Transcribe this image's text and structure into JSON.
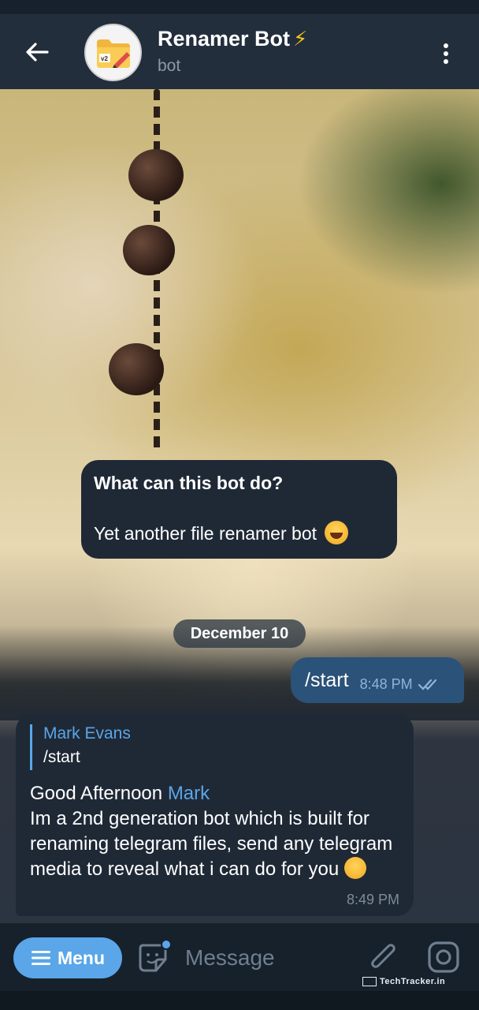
{
  "header": {
    "back_icon": "arrow-left-icon",
    "avatar_icon": "folder-rename-icon",
    "avatar_badge": "v2",
    "title": "Renamer Bot",
    "title_icon": "lightning-bolt-icon",
    "subtitle": "bot",
    "more_icon": "more-vertical-icon"
  },
  "messages": {
    "bot_info": {
      "question": "What can this bot do?",
      "answer": "Yet another file renamer bot",
      "answer_emoji": "laughing-tears-emoji"
    },
    "date_separator": "December 10",
    "outgoing": {
      "text": "/start",
      "time": "8:48 PM",
      "status_icon": "double-check-icon"
    },
    "incoming": {
      "reply_name": "Mark Evans",
      "reply_text": "/start",
      "greeting": "Good Afternoon",
      "mention": "Mark",
      "body": "Im a 2nd generation bot which is built for renaming telegram files, send any telegram media to reveal what i can do for you",
      "emoji": "smirk-emoji",
      "time": "8:49 PM"
    }
  },
  "composer": {
    "menu_label": "Menu",
    "menu_icon": "hamburger-icon",
    "sticker_icon": "sticker-icon",
    "placeholder": "Message",
    "attach_icon": "paperclip-icon",
    "camera_icon": "instagram-camera-icon"
  },
  "watermark": "TechTracker.in",
  "colors": {
    "header_bg": "#232e3c",
    "bubble_in": "#1f2936",
    "bubble_out": "#2b5278",
    "accent": "#5aa6e8",
    "bolt": "#f5c518"
  }
}
